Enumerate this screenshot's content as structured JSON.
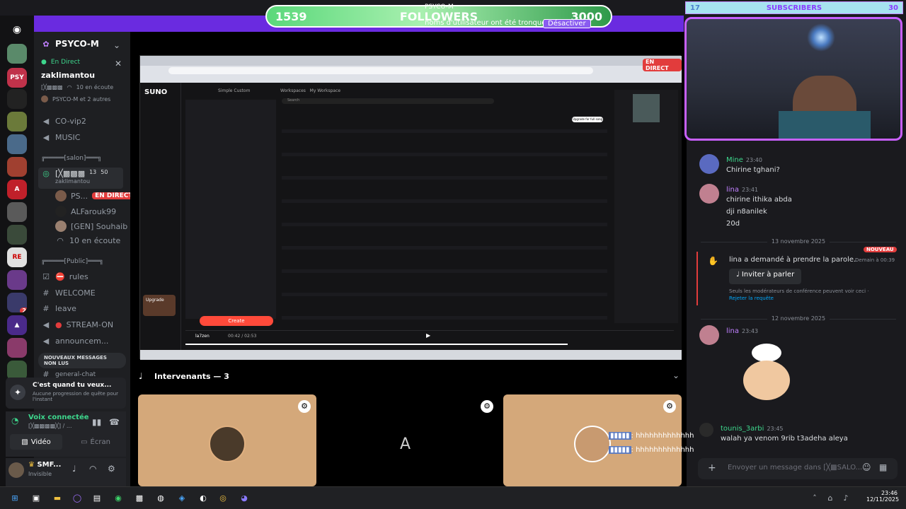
{
  "overlay": {
    "followers_current": "1539",
    "followers_label": "FOLLOWERS",
    "followers_goal": "3000",
    "notice_top": "PSYCO-M",
    "notice_text": "noms d'utilisateur ont été tronqués.",
    "notice_button": "Désactiver",
    "subs_count": "17",
    "subs_label": "SUBSCRIBERS",
    "subs_goal": "30"
  },
  "sidebar": {
    "server_name": "PSYCO-M",
    "live_label": "En Direct",
    "streamer": "zaklimantou",
    "listeners_top": "10 en écoute",
    "viewers_line": "PSYCO-M et 2 autres",
    "channels_top": [
      "CO-vip2",
      "MUSIC"
    ],
    "category_salon": "╔═════[salon]═══╗",
    "voice_channel": "[╳▩▩▩",
    "voice_counts": "13",
    "voice_limit": "50",
    "voice_sub": "zaklimantou",
    "members": [
      {
        "name": "PS...",
        "badge": "EN DIRECT"
      },
      {
        "name": "ALFarouk99"
      },
      {
        "name": "[GEN] Souhaib"
      },
      {
        "name": "10 en écoute"
      }
    ],
    "category_public": "╔═════[Public]═══╗",
    "text_channels": [
      "rules",
      "WELCOME",
      "leave",
      "STREAM-ON",
      "announcem..."
    ],
    "new_messages": "NOUVEAUX MESSAGES NON LUS",
    "channel_partial": "general-chat",
    "quest_title": "C'est quand tu veux...",
    "quest_sub": "Aucune progression de quête pour l'instant",
    "voice_connected": "Voix connectée",
    "voice_connected_sub": "[╳▩▩▩▩╳] / ...",
    "video_btn": "Vidéo",
    "screen_btn": "Écran",
    "user_name": "SMF...",
    "user_status": "Invisible"
  },
  "stream": {
    "live_badge": "EN DIRECT",
    "suno_logo": "SUNO",
    "suno_tabs": [
      "Simple",
      "Custom"
    ],
    "workspaces": [
      "Workspaces",
      "My Workspace"
    ],
    "search": "Search",
    "create_btn": "Create",
    "upgrade": "Upgrade",
    "track_title": "la7zen",
    "track_time": "00:42 / 02:53",
    "song_button": "Upgrade for full song"
  },
  "speakers": {
    "label": "Intervenants — 3"
  },
  "chat": {
    "messages": [
      {
        "user": "Mine",
        "time": "23:40",
        "lines": [
          "Chirine tghani?"
        ]
      },
      {
        "user": "lina",
        "time": "23:41",
        "lines": [
          "chirine ithika abda",
          "dji n8anilek",
          "20d"
        ]
      }
    ],
    "date1": "13 novembre 2025",
    "new_badge": "NOUVEAU",
    "request_text": "lina a demandé à prendre la parole.",
    "request_time": "Demain à 00:39",
    "invite_button": "Inviter à parler",
    "mod_note": "Seuls les modérateurs de conférence peuvent voir ceci ·",
    "reject_link": "Rejeter la requête",
    "date2": "12 novembre 2025",
    "lina_time": "23:43",
    "lina_user": "lina",
    "last_user": "tounis_3arbi",
    "last_time": "23:45",
    "last_text": "walah ya venom 9rib t3adeha aleya",
    "overlay_line": ": hhhhhhhhhhhhhhhhh",
    "input_placeholder": "Envoyer un message dans [╳▩SALO..."
  },
  "taskbar": {
    "time": "23:46",
    "date": "12/11/2025"
  }
}
